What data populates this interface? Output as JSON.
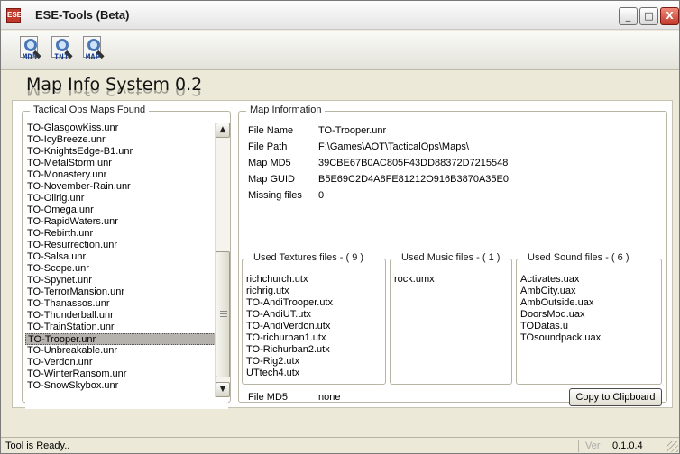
{
  "window": {
    "title": "ESE-Tools (Beta)",
    "min_symbol": "_",
    "max_symbol": "□",
    "close_symbol": "X"
  },
  "toolbar": {
    "buttons": [
      {
        "label": "MD5",
        "icon": "document-magnifier-icon"
      },
      {
        "label": "INI",
        "icon": "document-magnifier-icon"
      },
      {
        "label": "MAP",
        "icon": "document-magnifier-icon"
      }
    ]
  },
  "app_heading": "Map Info System 0.2",
  "maps_panel": {
    "title": "Tactical Ops Maps Found",
    "items": [
      "TO-GlasgowKiss.unr",
      "TO-IcyBreeze.unr",
      "TO-KnightsEdge-B1.unr",
      "TO-MetalStorm.unr",
      "TO-Monastery.unr",
      "TO-November-Rain.unr",
      "TO-Oilrig.unr",
      "TO-Omega.unr",
      "TO-RapidWaters.unr",
      "TO-Rebirth.unr",
      "TO-Resurrection.unr",
      "TO-Salsa.unr",
      "TO-Scope.unr",
      "TO-Spynet.unr",
      "TO-TerrorMansion.unr",
      "TO-Thanassos.unr",
      "TO-Thunderball.unr",
      "TO-TrainStation.unr",
      "TO-Trooper.unr",
      "TO-Unbreakable.unr",
      "TO-Verdon.unr",
      "TO-WinterRansom.unr",
      "TO-SnowSkybox.unr"
    ],
    "selected_index": 18
  },
  "map_info": {
    "title": "Map Information",
    "fields": [
      {
        "label": "File Name",
        "value": "TO-Trooper.unr"
      },
      {
        "label": "File Path",
        "value": "F:\\Games\\AOT\\TacticalOps\\Maps\\"
      },
      {
        "label": "Map MD5",
        "value": "39CBE67B0AC805F43DD88372D7215548"
      },
      {
        "label": "Map GUID",
        "value": "B5E69C2D4A8FE81212O916B3870A35E0"
      },
      {
        "label": "Missing files",
        "value": "0"
      }
    ],
    "textures": {
      "title": "Used Textures files - ( 9 )",
      "files": [
        "richchurch.utx",
        "richrig.utx",
        "TO-AndiTrooper.utx",
        "TO-AndiUT.utx",
        "TO-AndiVerdon.utx",
        "TO-richurban1.utx",
        "TO-Richurban2.utx",
        "TO-Rig2.utx",
        "UTtech4.utx"
      ]
    },
    "music": {
      "title": "Used Music files - ( 1 )",
      "files": [
        "rock.umx"
      ]
    },
    "sound": {
      "title": "Used Sound files - ( 6 )",
      "files": [
        "Activates.uax",
        "AmbCity.uax",
        "AmbOutside.uax",
        "DoorsMod.uax",
        "TODatas.u",
        "TOsoundpack.uax"
      ]
    },
    "file_md5_label": "File MD5",
    "file_md5_value": "none",
    "copy_button": "Copy to Clipboard"
  },
  "statusbar": {
    "status": "Tool is Ready..",
    "version_label": "Ver",
    "version": "0.1.0.4"
  }
}
